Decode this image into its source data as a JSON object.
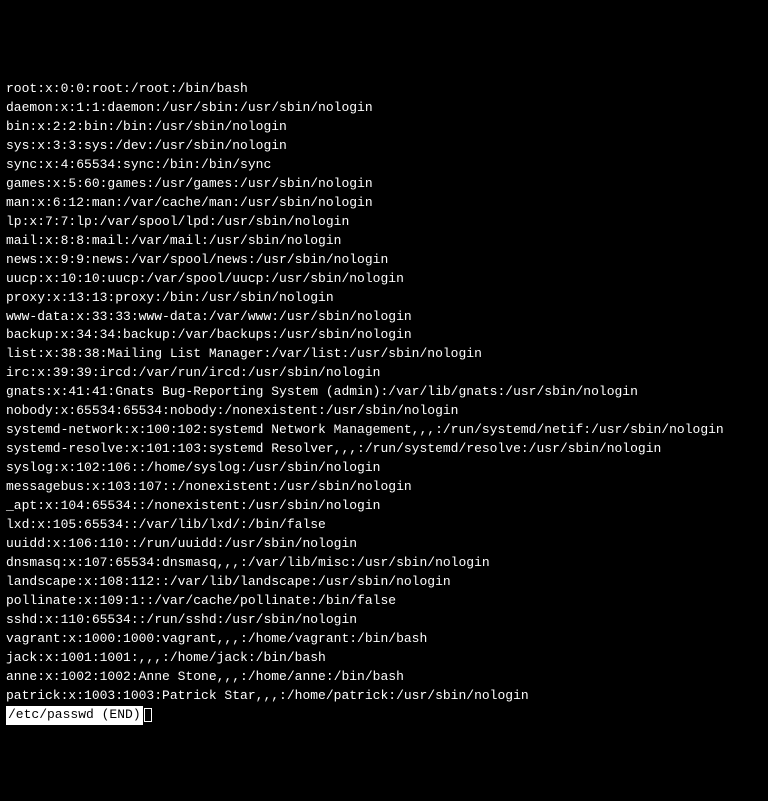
{
  "lines": [
    "root:x:0:0:root:/root:/bin/bash",
    "daemon:x:1:1:daemon:/usr/sbin:/usr/sbin/nologin",
    "bin:x:2:2:bin:/bin:/usr/sbin/nologin",
    "sys:x:3:3:sys:/dev:/usr/sbin/nologin",
    "sync:x:4:65534:sync:/bin:/bin/sync",
    "games:x:5:60:games:/usr/games:/usr/sbin/nologin",
    "man:x:6:12:man:/var/cache/man:/usr/sbin/nologin",
    "lp:x:7:7:lp:/var/spool/lpd:/usr/sbin/nologin",
    "mail:x:8:8:mail:/var/mail:/usr/sbin/nologin",
    "news:x:9:9:news:/var/spool/news:/usr/sbin/nologin",
    "uucp:x:10:10:uucp:/var/spool/uucp:/usr/sbin/nologin",
    "proxy:x:13:13:proxy:/bin:/usr/sbin/nologin",
    "www-data:x:33:33:www-data:/var/www:/usr/sbin/nologin",
    "backup:x:34:34:backup:/var/backups:/usr/sbin/nologin",
    "list:x:38:38:Mailing List Manager:/var/list:/usr/sbin/nologin",
    "irc:x:39:39:ircd:/var/run/ircd:/usr/sbin/nologin",
    "gnats:x:41:41:Gnats Bug-Reporting System (admin):/var/lib/gnats:/usr/sbin/nologin",
    "nobody:x:65534:65534:nobody:/nonexistent:/usr/sbin/nologin",
    "systemd-network:x:100:102:systemd Network Management,,,:/run/systemd/netif:/usr/sbin/nologin",
    "systemd-resolve:x:101:103:systemd Resolver,,,:/run/systemd/resolve:/usr/sbin/nologin",
    "syslog:x:102:106::/home/syslog:/usr/sbin/nologin",
    "messagebus:x:103:107::/nonexistent:/usr/sbin/nologin",
    "_apt:x:104:65534::/nonexistent:/usr/sbin/nologin",
    "lxd:x:105:65534::/var/lib/lxd/:/bin/false",
    "uuidd:x:106:110::/run/uuidd:/usr/sbin/nologin",
    "dnsmasq:x:107:65534:dnsmasq,,,:/var/lib/misc:/usr/sbin/nologin",
    "landscape:x:108:112::/var/lib/landscape:/usr/sbin/nologin",
    "pollinate:x:109:1::/var/cache/pollinate:/bin/false",
    "sshd:x:110:65534::/run/sshd:/usr/sbin/nologin",
    "vagrant:x:1000:1000:vagrant,,,:/home/vagrant:/bin/bash",
    "jack:x:1001:1001:,,,:/home/jack:/bin/bash",
    "anne:x:1002:1002:Anne Stone,,,:/home/anne:/bin/bash",
    "patrick:x:1003:1003:Patrick Star,,,:/home/patrick:/usr/sbin/nologin"
  ],
  "status": "/etc/passwd (END)"
}
